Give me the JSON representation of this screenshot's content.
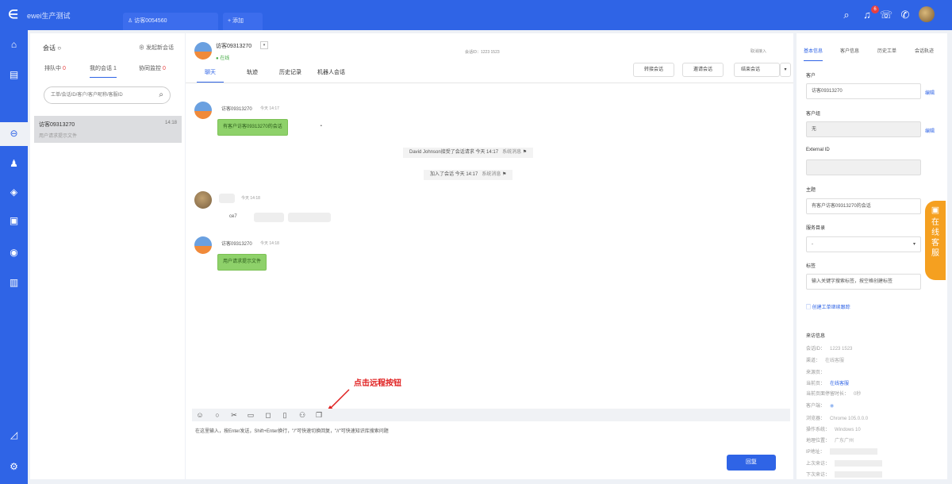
{
  "topbar": {
    "brand": "ewei生产测试",
    "tabs": [
      {
        "label": "访客0054560"
      },
      {
        "label": "+ 添加"
      }
    ],
    "notif_count": "6",
    "icons": [
      "search-icon",
      "bell-icon",
      "phone-transfer-icon",
      "phone-icon",
      "avatar"
    ]
  },
  "conversations": {
    "title": "会话",
    "new_label": "发起新会话",
    "tabs": [
      {
        "label": "排队中",
        "count": "0"
      },
      {
        "label": "我的会话",
        "count": "1"
      },
      {
        "label": "协同监控",
        "count": "0"
      }
    ],
    "search_placeholder": "工单/会话ID/客户/客户昵称/客服ID",
    "items": [
      {
        "name": "访客09313270",
        "time": "14:18",
        "preview": "用户请求提示文件"
      }
    ]
  },
  "chat": {
    "header": {
      "name": "访客09313270",
      "status": "在线",
      "mid_text": "会话ID：1223 1523",
      "right_text": "取消接入"
    },
    "subtabs": [
      "聊天",
      "轨迹",
      "历史记录",
      "机器人会话"
    ],
    "buttons": [
      "转接会话",
      "邀请会话",
      "结束会话"
    ],
    "messages": [
      {
        "name": "访客09313270",
        "time": "今天 14:17",
        "text": "有客户访客09313270的会话"
      },
      {
        "system": "David Johnson接受了会话请求 今天 14:17",
        "tag": "系统消息"
      },
      {
        "system": "加入了会话 今天 14:17",
        "tag": "系统消息"
      },
      {
        "name": "",
        "time": "今天 14:18",
        "text": "ce7"
      },
      {
        "name": "访客09313270",
        "time": "今天 14:18",
        "text": "用户请求提示文件"
      }
    ],
    "annotation": "点击远程按钮",
    "input_placeholder": "在这里输入，按Enter发送，Shift+Enter换行，\"/\"可快速切换回复，\"//\"可快速知识库搜索问题",
    "send_label": "回复"
  },
  "right": {
    "tabs": [
      "基本信息",
      "客户信息",
      "历史工单",
      "会话轨迹"
    ],
    "fields": [
      {
        "label": "客户",
        "value": "访客09313270",
        "link": "编辑"
      },
      {
        "label": "客户组",
        "value": "无",
        "link": "编辑"
      },
      {
        "label": "External ID",
        "value": ""
      },
      {
        "label": "主题",
        "value": "有客户访客09313270的会话"
      },
      {
        "label": "服务目录",
        "value": "-"
      },
      {
        "label": "标签",
        "value": "输入关键字搜索标签，按空格创建标签"
      }
    ],
    "create_ticket": "创建工单继续跟踪",
    "visit_title": "来访信息",
    "visit": [
      {
        "k": "会话ID：",
        "v": "1223 1523"
      },
      {
        "k": "渠道：",
        "v": "在线客服"
      },
      {
        "k": "来源页：",
        "v": ""
      },
      {
        "k": "当前页：",
        "v": "在线客服"
      },
      {
        "k": "当前页面停留时长：",
        "v": "0秒"
      },
      {
        "k": "客户端：",
        "v": ""
      },
      {
        "k": "浏览器：",
        "v": "Chrome 105.0.0.0"
      },
      {
        "k": "操作系统：",
        "v": "Windows 10"
      },
      {
        "k": "地理位置：",
        "v": "广东广州"
      },
      {
        "k": "IP地址：",
        "v": ""
      },
      {
        "k": "上次来访：",
        "v": ""
      },
      {
        "k": "下次来访：",
        "v": ""
      }
    ]
  },
  "floating": {
    "label": "在线客服"
  }
}
